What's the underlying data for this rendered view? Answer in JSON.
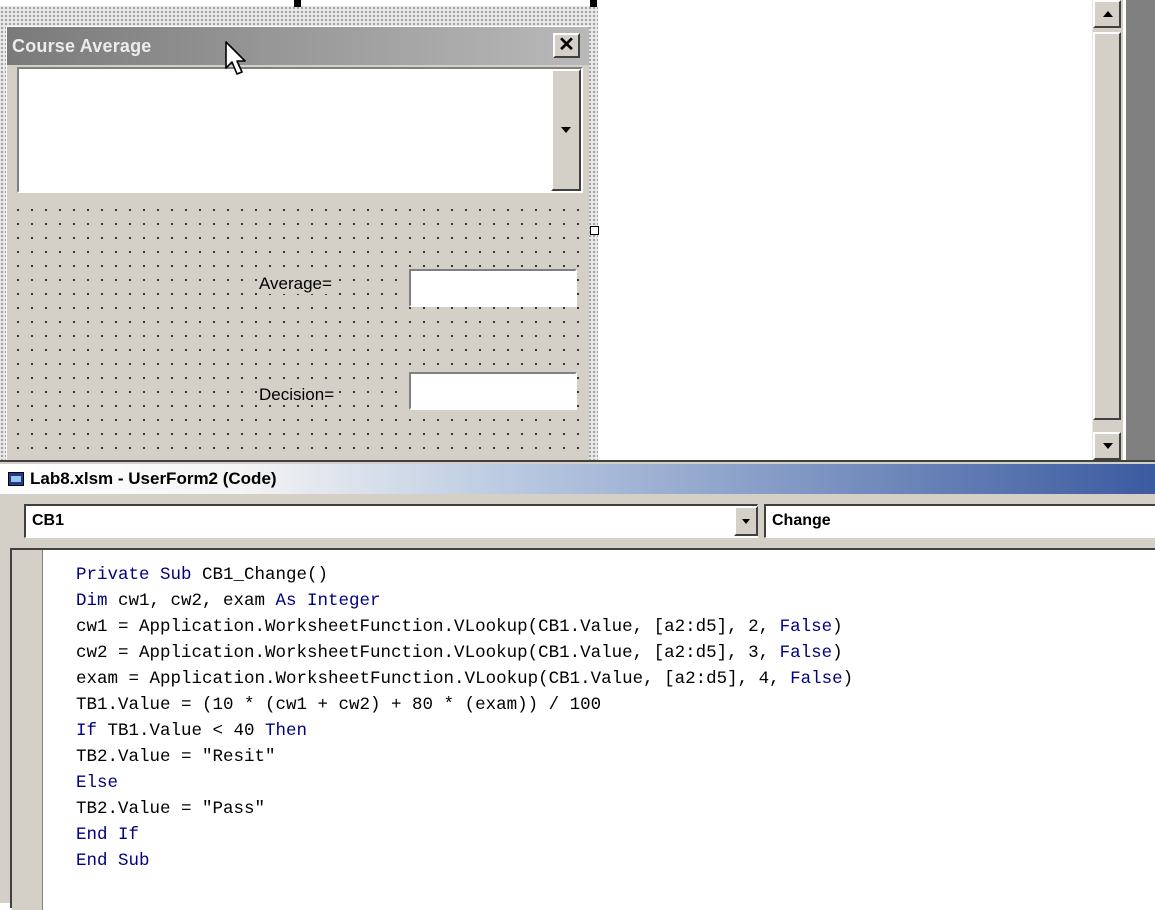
{
  "designer": {
    "form_title": "Course Average",
    "close_glyph": "✕",
    "labels": {
      "average": "Average=",
      "decision": "Decision="
    }
  },
  "code_window": {
    "title": "Lab8.xlsm - UserForm2 (Code)",
    "object_dropdown": "CB1",
    "procedure_dropdown": "Change",
    "lines": [
      [
        {
          "t": "Private Sub ",
          "k": true
        },
        {
          "t": "CB1_Change()"
        }
      ],
      [
        {
          "t": "Dim ",
          "k": true
        },
        {
          "t": "cw1, cw2, exam "
        },
        {
          "t": "As Integer",
          "k": true
        }
      ],
      [
        {
          "t": "cw1 = Application.WorksheetFunction.VLookup(CB1.Value, [a2:d5], 2, "
        },
        {
          "t": "False",
          "k": true
        },
        {
          "t": ")"
        }
      ],
      [
        {
          "t": "cw2 = Application.WorksheetFunction.VLookup(CB1.Value, [a2:d5], 3, "
        },
        {
          "t": "False",
          "k": true
        },
        {
          "t": ")"
        }
      ],
      [
        {
          "t": "exam = Application.WorksheetFunction.VLookup(CB1.Value, [a2:d5], 4, "
        },
        {
          "t": "False",
          "k": true
        },
        {
          "t": ")"
        }
      ],
      [
        {
          "t": "TB1.Value = (10 * (cw1 + cw2) + 80 * (exam)) / 100"
        }
      ],
      [
        {
          "t": "If ",
          "k": true
        },
        {
          "t": "TB1.Value < 40 "
        },
        {
          "t": "Then",
          "k": true
        }
      ],
      [
        {
          "t": "TB2.Value = \"Resit\""
        }
      ],
      [
        {
          "t": "Else",
          "k": true
        }
      ],
      [
        {
          "t": "TB2.Value = \"Pass\""
        }
      ],
      [
        {
          "t": "End If",
          "k": true
        }
      ],
      [
        {
          "t": "End Sub",
          "k": true
        }
      ]
    ]
  },
  "colors": {
    "keyword": "#000080",
    "form_face": "#d4d0c8",
    "titlebar_active": "#3b5aa0"
  },
  "icons": [
    "close-icon",
    "dropdown-arrow-icon",
    "scroll-up-icon",
    "scroll-down-icon",
    "mouse-pointer-icon",
    "code-window-icon"
  ]
}
